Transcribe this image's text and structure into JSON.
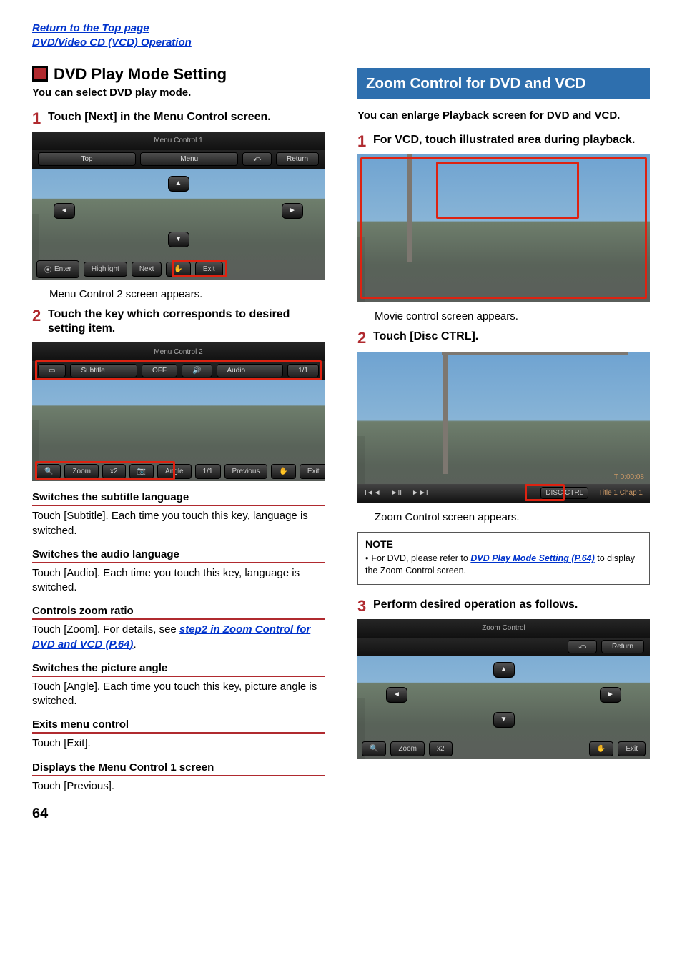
{
  "header": {
    "link_top": "Return to the Top page",
    "link_section": "DVD/Video CD (VCD) Operation"
  },
  "left": {
    "title": "DVD Play Mode Setting",
    "intro": "You can select DVD play mode.",
    "step1": {
      "num": "1",
      "text": "Touch [Next] in the Menu Control screen."
    },
    "fig1": {
      "title_bar": "Menu Control 1",
      "btn_top": "Top",
      "btn_menu": "Menu",
      "btn_return": "Return",
      "btn_enter": "Enter",
      "btn_highlight": "Highlight",
      "btn_next": "Next",
      "btn_exit": "Exit"
    },
    "caption1": "Menu Control 2 screen appears.",
    "step2": {
      "num": "2",
      "text": "Touch the key which corresponds to desired setting item."
    },
    "fig2": {
      "title_bar": "Menu Control 2",
      "btn_subtitle": "Subtitle",
      "btn_off": "OFF",
      "btn_audio": "Audio",
      "btn_aval": "1/1",
      "btn_zoom": "Zoom",
      "btn_zval": "x2",
      "btn_angle": "Angle",
      "btn_anval": "1/1",
      "btn_previous": "Previous",
      "btn_exit": "Exit"
    },
    "defs": [
      {
        "head": "Switches the subtitle language",
        "body": "Touch [Subtitle]. Each time you touch this key, language is switched."
      },
      {
        "head": "Switches the audio language",
        "body": "Touch [Audio]. Each time you touch this key, language is switched."
      },
      {
        "head": "Controls zoom ratio",
        "body_pre": "Touch [Zoom]. For details, see ",
        "link": "step2 in Zoom Control for DVD and VCD (P.64)",
        "body_post": "."
      },
      {
        "head": "Switches the picture angle",
        "body": "Touch [Angle]. Each time you touch this key, picture angle is switched."
      },
      {
        "head": "Exits menu control",
        "body": "Touch [Exit]."
      },
      {
        "head": "Displays the Menu Control 1 screen",
        "body": "Touch [Previous]."
      }
    ]
  },
  "right": {
    "banner": "Zoom Control for DVD and VCD",
    "intro": "You can enlarge Playback screen for DVD and VCD.",
    "step1": {
      "num": "1",
      "text": "For VCD, touch illustrated area during playback."
    },
    "caption1": "Movie control screen appears.",
    "step2": {
      "num": "2",
      "text": "Touch [Disc CTRL]."
    },
    "fig_disc": {
      "prev": "I◄◄",
      "play": "►II",
      "next": "►►I",
      "disc_ctrl": "DISC CTRL",
      "title_info": "Title 1 Chap 1",
      "time": "T 0:00:08"
    },
    "caption2": "Zoom Control screen appears.",
    "note": {
      "title": "NOTE",
      "body_pre": "For DVD, please refer to ",
      "link": "DVD Play Mode Setting (P.64)",
      "body_post": " to display the Zoom Control screen."
    },
    "step3": {
      "num": "3",
      "text": "Perform desired operation as follows."
    },
    "fig_zoom": {
      "title_bar": "Zoom Control",
      "btn_return": "Return",
      "btn_zoom": "Zoom",
      "btn_zval": "x2",
      "btn_exit": "Exit"
    }
  },
  "page_number": "64"
}
